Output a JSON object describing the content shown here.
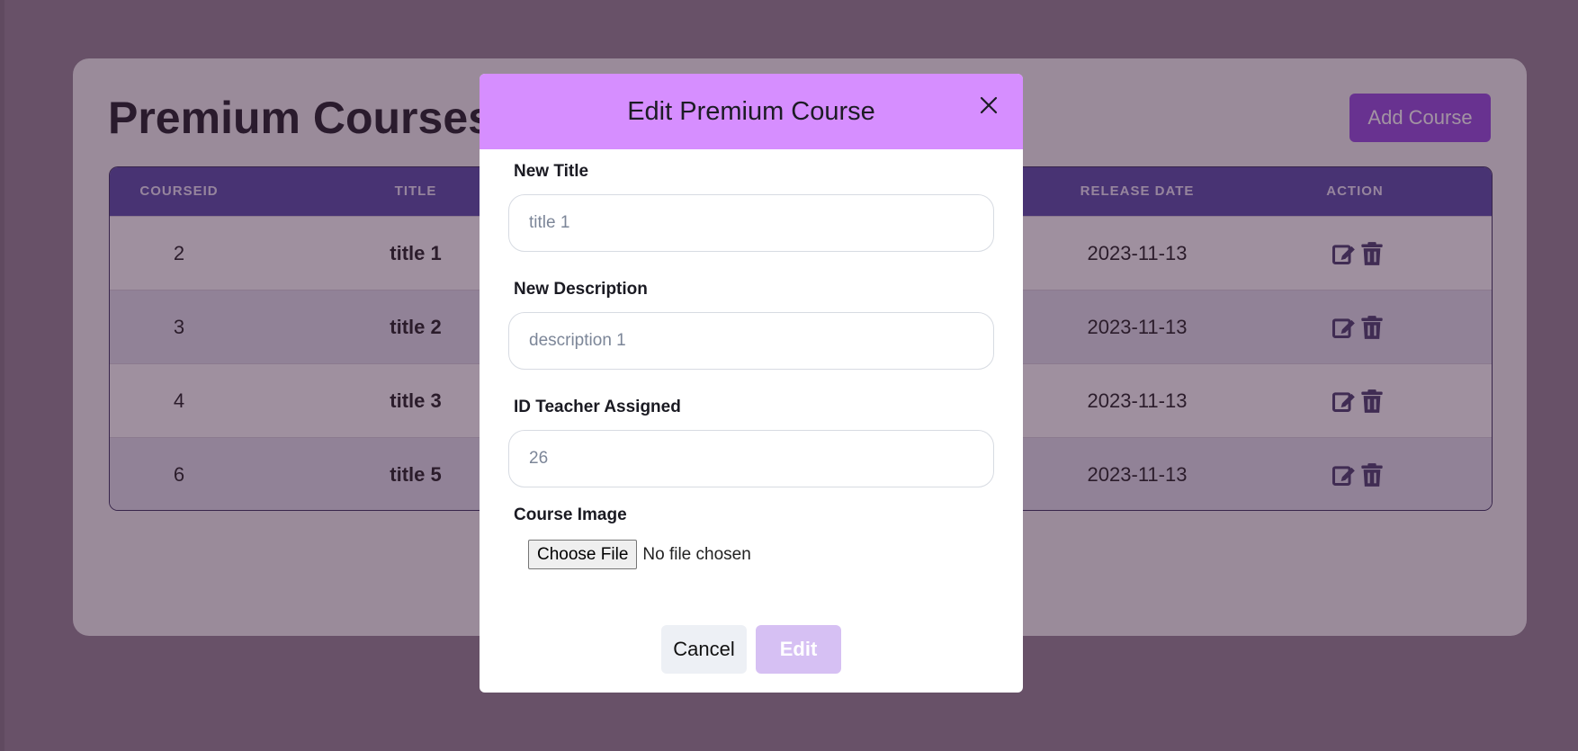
{
  "page": {
    "title": "Premium Courses",
    "add_button_label": "Add Course"
  },
  "table": {
    "headers": [
      "COURSEID",
      "TITLE",
      "RELEASE DATE",
      "ACTION"
    ],
    "rows": [
      {
        "id": "2",
        "title": "title 1",
        "release_date": "2023-11-13"
      },
      {
        "id": "3",
        "title": "title 2",
        "release_date": "2023-11-13"
      },
      {
        "id": "4",
        "title": "title 3",
        "release_date": "2023-11-13"
      },
      {
        "id": "6",
        "title": "title 5",
        "release_date": "2023-11-13"
      }
    ],
    "row_action_icons": [
      "edit-icon",
      "trash-icon"
    ]
  },
  "modal": {
    "title": "Edit Premium Course",
    "close_icon": "close-icon",
    "fields": {
      "title": {
        "label": "New Title",
        "placeholder": "title 1",
        "value": ""
      },
      "description": {
        "label": "New Description",
        "placeholder": "description 1",
        "value": ""
      },
      "teacher": {
        "label": "ID Teacher Assigned",
        "placeholder": "26",
        "value": ""
      }
    },
    "image": {
      "label": "Course Image",
      "button_label": "Choose File",
      "status": "No file chosen"
    },
    "cancel_label": "Cancel",
    "edit_label": "Edit"
  },
  "colors": {
    "modal_header": "#d68eff",
    "table_header": "#4a3ea0",
    "add_button": "#8a3ddb",
    "edit_button_disabled": "#d6c0f3",
    "overlay": "rgba(70,40,70,0.5)"
  }
}
